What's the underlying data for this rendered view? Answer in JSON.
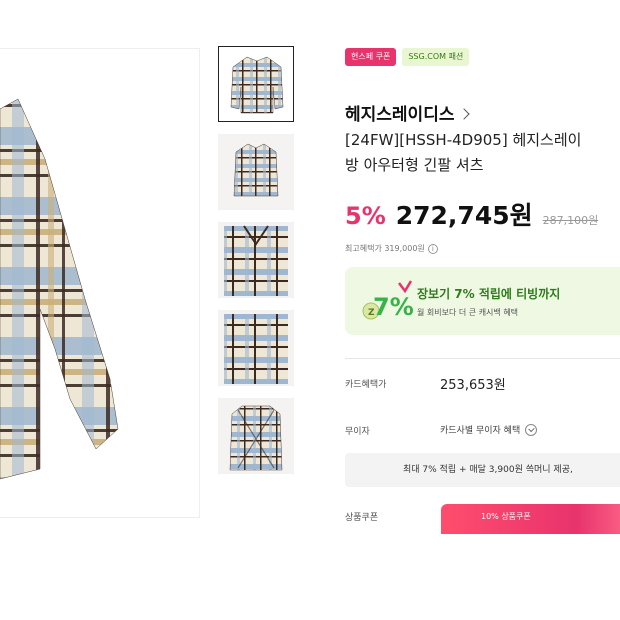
{
  "thumbnails": [
    {
      "name": "thumb-front-view",
      "active": true
    },
    {
      "name": "thumb-folded-view",
      "active": false
    },
    {
      "name": "thumb-collar-detail",
      "active": false
    },
    {
      "name": "thumb-fabric-detail",
      "active": false
    },
    {
      "name": "thumb-back-view",
      "active": false
    }
  ],
  "badges": {
    "coupon": "현스페 쿠폰",
    "channel": "SSG.COM 패션"
  },
  "brand": "헤지스레이디스",
  "title_line1": "[24FW][HSSH-4D905] 헤지스레이",
  "title_line2": "방 아우터형 긴팔 셔츠",
  "price": {
    "discount": "5%",
    "sale": "272,745원",
    "original": "287,100원",
    "max_benefit_label": "최고혜택가 319,000원"
  },
  "promo": {
    "logo_text": "7%",
    "headline": "장보기 7% 적립에 티빙까지",
    "subtext": "월 회비보다 더 큰 캐시백 혜택"
  },
  "details": {
    "card_benefit_label": "카드혜택가",
    "card_benefit_value": "253,653원",
    "interest_label": "무이자",
    "interest_value": "카드사별 무이자 혜택",
    "benefit_bar": "최대 7% 적립 + 매달 3,900원 쓱머니 제공,",
    "coupon_label": "상품쿠폰",
    "coupon_button": "10% 상품쿠폰"
  },
  "colors": {
    "accent_pink": "#e8336d",
    "promo_green": "#2f7c1c",
    "promo_bg": "#eef8e3"
  }
}
